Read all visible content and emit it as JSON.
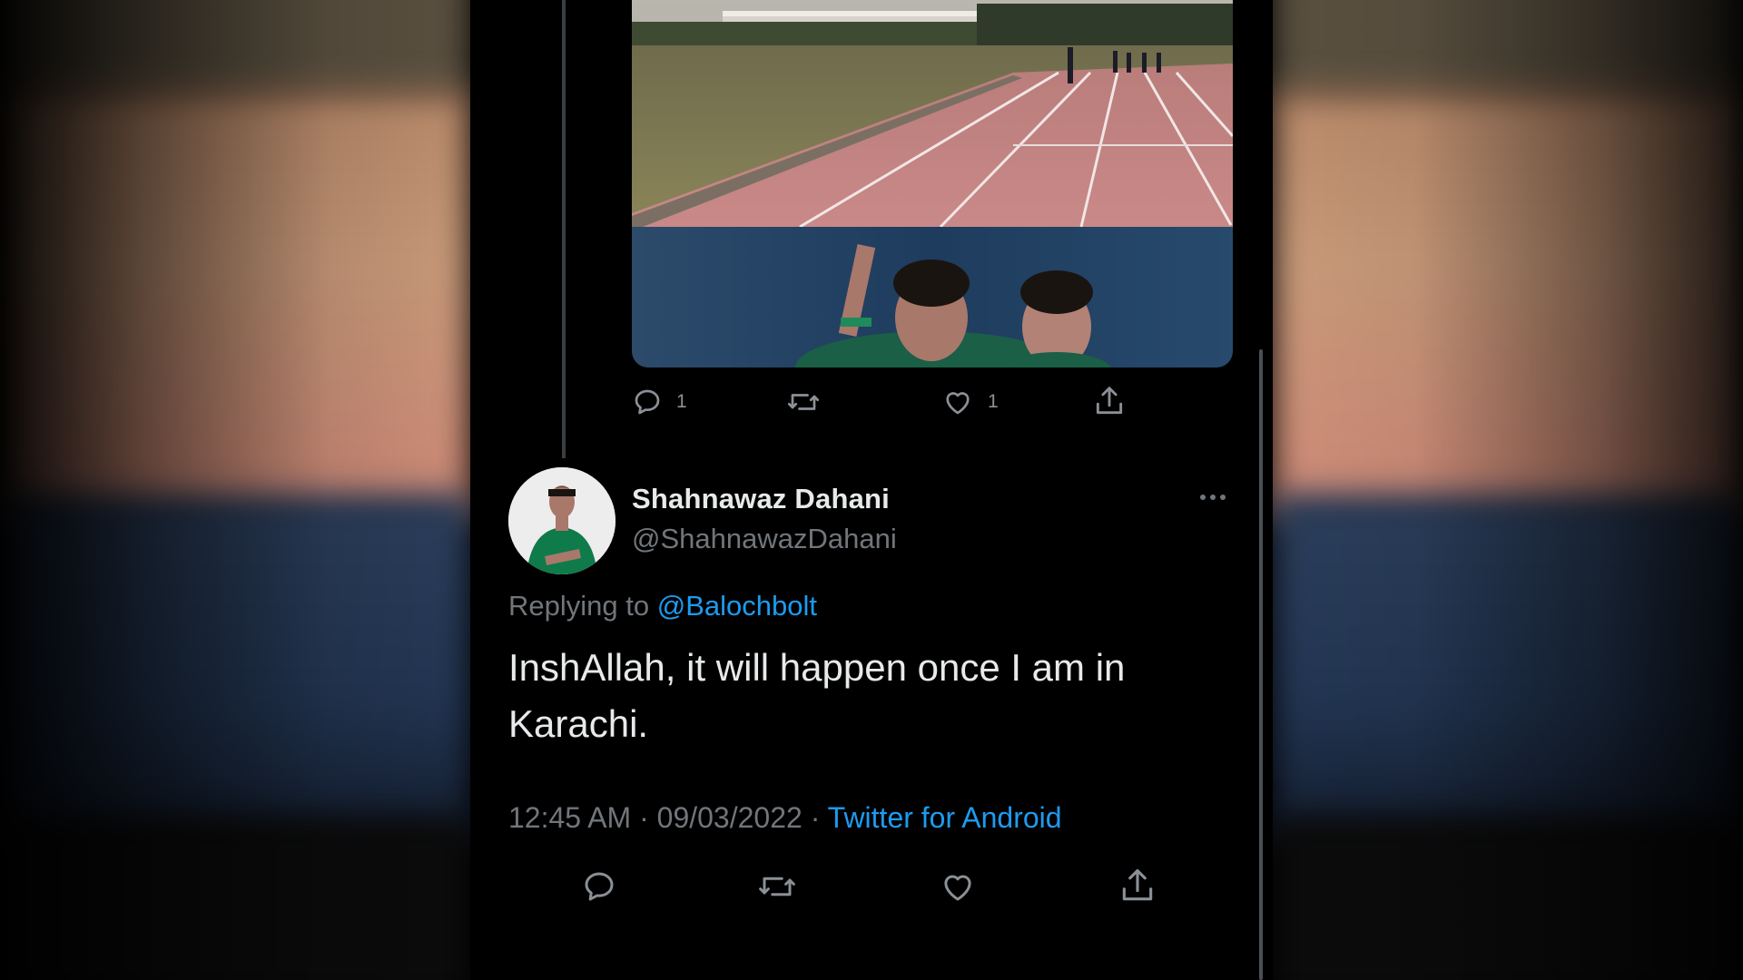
{
  "thread_action_bar": {
    "reply_count": "1",
    "like_count": "1",
    "icons": [
      "reply-icon",
      "retweet-icon",
      "like-icon",
      "share-icon"
    ]
  },
  "tweet": {
    "display_name": "Shahnawaz Dahani",
    "handle": "@ShahnawazDahani",
    "replying_prefix": "Replying to ",
    "replying_to": "@Balochbolt",
    "text": "InshAllah, it will happen once I am in Karachi.",
    "time": "12:45 AM",
    "separator": " · ",
    "date": "09/03/2022",
    "source": "Twitter for Android"
  },
  "tweet_action_bar": {
    "icons": [
      "reply-icon",
      "retweet-icon",
      "like-icon",
      "share-icon"
    ]
  },
  "colors": {
    "background": "#000000",
    "primary_text": "#e7e9ea",
    "secondary_text": "#71767b",
    "link": "#1d9bf0"
  }
}
